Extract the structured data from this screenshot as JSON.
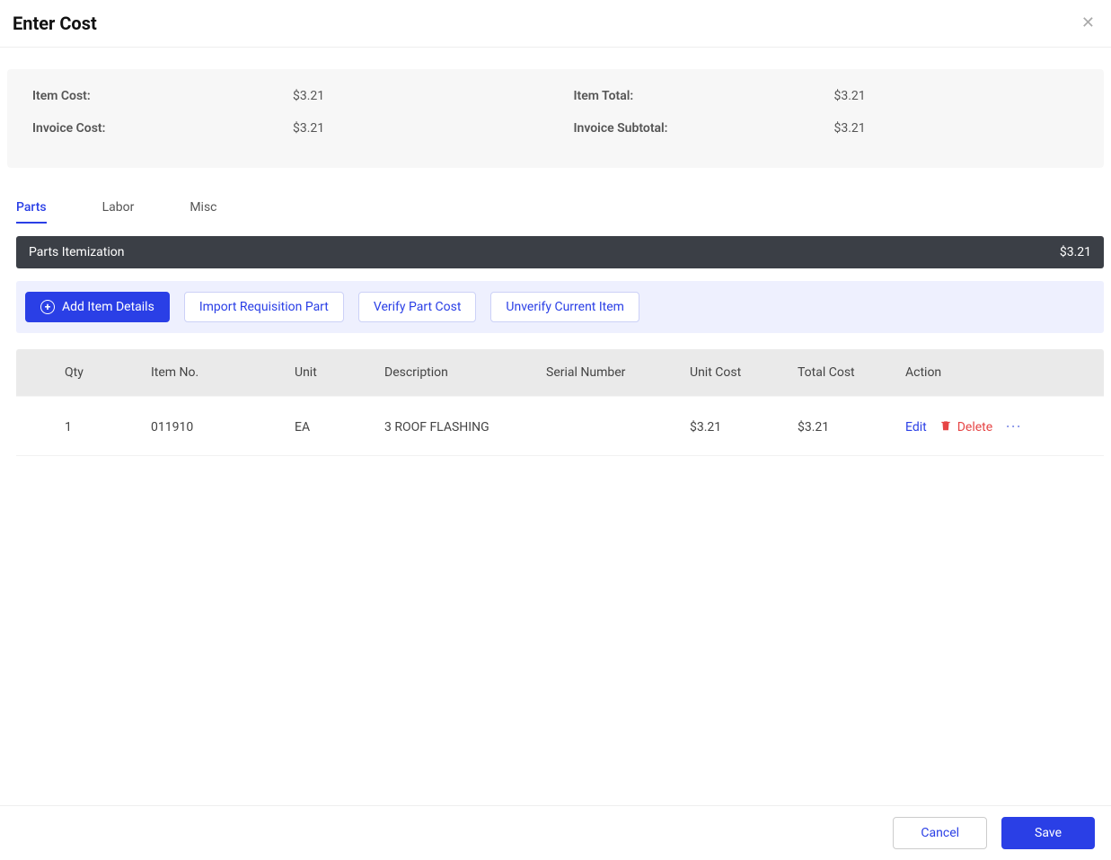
{
  "header": {
    "title": "Enter Cost"
  },
  "summary": {
    "item_cost_label": "Item Cost:",
    "item_cost_value": "$3.21",
    "item_total_label": "Item Total:",
    "item_total_value": "$3.21",
    "invoice_cost_label": "Invoice Cost:",
    "invoice_cost_value": "$3.21",
    "invoice_subtotal_label": "Invoice Subtotal:",
    "invoice_subtotal_value": "$3.21"
  },
  "tabs": {
    "parts": "Parts",
    "labor": "Labor",
    "misc": "Misc"
  },
  "section": {
    "title": "Parts Itemization",
    "amount": "$3.21"
  },
  "actions": {
    "add_item": "Add Item Details",
    "import_req": "Import Requisition Part",
    "verify": "Verify Part Cost",
    "unverify": "Unverify Current Item"
  },
  "table": {
    "headers": {
      "qty": "Qty",
      "item_no": "Item No.",
      "unit": "Unit",
      "description": "Description",
      "serial": "Serial Number",
      "unit_cost": "Unit Cost",
      "total_cost": "Total Cost",
      "action": "Action"
    },
    "rows": [
      {
        "qty": "1",
        "item_no": "011910",
        "unit": "EA",
        "description": "3 ROOF FLASHING",
        "serial": "",
        "unit_cost": "$3.21",
        "total_cost": "$3.21"
      }
    ],
    "row_actions": {
      "edit": "Edit",
      "delete": "Delete"
    }
  },
  "footer": {
    "cancel": "Cancel",
    "save": "Save"
  }
}
